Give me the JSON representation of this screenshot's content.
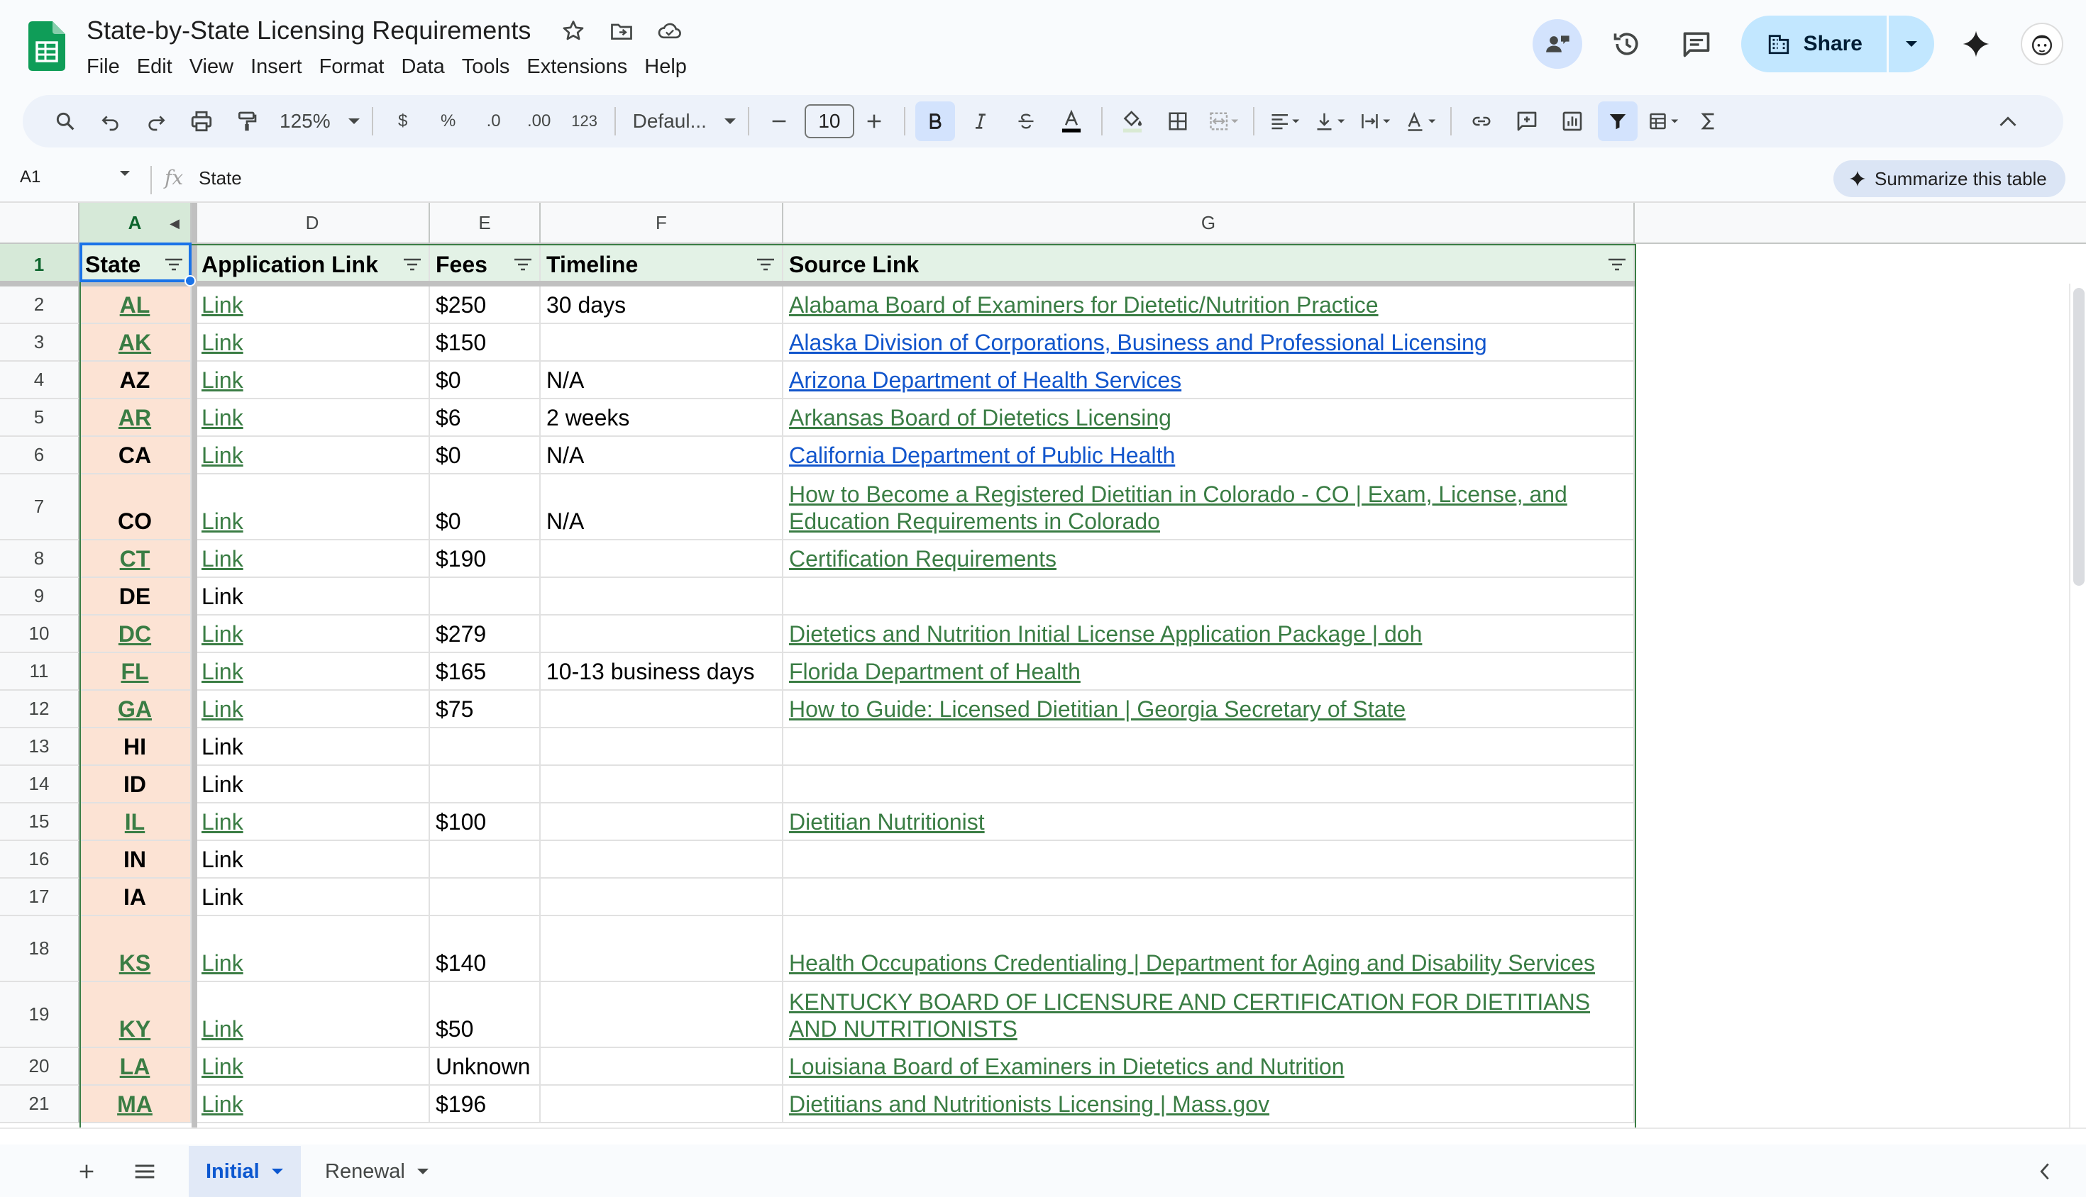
{
  "title": "State-by-State Licensing Requirements",
  "menu": [
    "File",
    "Edit",
    "View",
    "Insert",
    "Format",
    "Data",
    "Tools",
    "Extensions",
    "Help"
  ],
  "share_label": "Share",
  "toolbar": {
    "zoom": "125%",
    "font": "Defaul...",
    "font_size": "10",
    "currency": "$",
    "percent": "%",
    "dec_decrease": ".0",
    "dec_increase": ".00",
    "number_format": "123"
  },
  "formula_bar": {
    "cell_ref": "A1",
    "fx": "fx",
    "content": "State",
    "summarize_label": "Summarize this table"
  },
  "columns": [
    "A",
    "D",
    "E",
    "F",
    "G"
  ],
  "headers": {
    "state": "State",
    "app": "Application Link",
    "fees": "Fees",
    "timeline": "Timeline",
    "source": "Source Link"
  },
  "rows": [
    {
      "n": "1"
    },
    {
      "n": "2",
      "state": "AL",
      "state_link": true,
      "app": "Link",
      "app_link": true,
      "fees": "$250",
      "timeline": "30 days",
      "source": "Alabama Board of Examiners for Dietetic/Nutrition Practice",
      "source_color": "green"
    },
    {
      "n": "3",
      "state": "AK",
      "state_link": true,
      "app": "Link",
      "app_link": true,
      "fees": "$150",
      "timeline": "",
      "source": "Alaska Division of Corporations, Business and Professional Licensing",
      "source_color": "blue"
    },
    {
      "n": "4",
      "state": "AZ",
      "state_link": false,
      "app": "Link",
      "app_link": true,
      "fees": "$0",
      "timeline": "N/A",
      "source": "Arizona Department of Health Services",
      "source_color": "blue"
    },
    {
      "n": "5",
      "state": "AR",
      "state_link": true,
      "app": "Link",
      "app_link": true,
      "fees": "$6",
      "timeline": "2 weeks",
      "source": "Arkansas Board of Dietetics Licensing",
      "source_color": "green"
    },
    {
      "n": "6",
      "state": "CA",
      "state_link": false,
      "app": "Link",
      "app_link": true,
      "fees": "$0",
      "timeline": "N/A",
      "source": "California Department of Public Health",
      "source_color": "blue"
    },
    {
      "n": "7",
      "state": "CO",
      "state_link": false,
      "app": "Link",
      "app_link": true,
      "fees": "$0",
      "timeline": "N/A",
      "source": "How to Become a Registered Dietitian in Colorado - CO | Exam, License, and Education Requirements in Colorado",
      "source_color": "green",
      "tall": true
    },
    {
      "n": "8",
      "state": "CT",
      "state_link": true,
      "app": "Link",
      "app_link": true,
      "fees": "$190",
      "timeline": "",
      "source": "Certification Requirements",
      "source_color": "green"
    },
    {
      "n": "9",
      "state": "DE",
      "state_link": false,
      "app": "Link",
      "app_link": false,
      "fees": "",
      "timeline": "",
      "source": "",
      "source_color": "green"
    },
    {
      "n": "10",
      "state": "DC",
      "state_link": true,
      "app": "Link",
      "app_link": true,
      "fees": "$279",
      "timeline": "",
      "source": "Dietetics and Nutrition Initial License Application Package | doh",
      "source_color": "green"
    },
    {
      "n": "11",
      "state": "FL",
      "state_link": true,
      "app": "Link",
      "app_link": true,
      "fees": "$165",
      "timeline": "10-13 business days",
      "source": "Florida Department of Health",
      "source_color": "green"
    },
    {
      "n": "12",
      "state": "GA",
      "state_link": true,
      "app": "Link",
      "app_link": true,
      "fees": "$75",
      "timeline": "",
      "source": "How to Guide: Licensed Dietitian | Georgia Secretary of State",
      "source_color": "green"
    },
    {
      "n": "13",
      "state": "HI",
      "state_link": false,
      "app": "Link",
      "app_link": false,
      "fees": "",
      "timeline": "",
      "source": "",
      "source_color": "green"
    },
    {
      "n": "14",
      "state": "ID",
      "state_link": false,
      "app": "Link",
      "app_link": false,
      "fees": "",
      "timeline": "",
      "source": "",
      "source_color": "green"
    },
    {
      "n": "15",
      "state": "IL",
      "state_link": true,
      "app": "Link",
      "app_link": true,
      "fees": "$100",
      "timeline": "",
      "source": "Dietitian Nutritionist",
      "source_color": "green"
    },
    {
      "n": "16",
      "state": "IN",
      "state_link": false,
      "app": "Link",
      "app_link": false,
      "fees": "",
      "timeline": "",
      "source": "",
      "source_color": "green"
    },
    {
      "n": "17",
      "state": "IA",
      "state_link": false,
      "app": "Link",
      "app_link": false,
      "fees": "",
      "timeline": "",
      "source": "",
      "source_color": "green"
    },
    {
      "n": "18",
      "state": "KS",
      "state_link": true,
      "app": "Link",
      "app_link": true,
      "fees": "$140",
      "timeline": "",
      "source": "Health Occupations Credentialing | Department for Aging and Disability Services",
      "source_color": "green",
      "tall": true
    },
    {
      "n": "19",
      "state": "KY",
      "state_link": true,
      "app": "Link",
      "app_link": true,
      "fees": "$50",
      "timeline": "",
      "source": "KENTUCKY BOARD OF LICENSURE AND CERTIFICATION FOR DIETITIANS AND NUTRITIONISTS",
      "source_color": "green",
      "tall": true
    },
    {
      "n": "20",
      "state": "LA",
      "state_link": true,
      "app": "Link",
      "app_link": true,
      "fees": "Unknown",
      "timeline": "",
      "source": "Louisiana Board of Examiners in Dietetics and Nutrition",
      "source_color": "green"
    },
    {
      "n": "21",
      "state": "MA",
      "state_link": true,
      "app": "Link",
      "app_link": true,
      "fees": "$196",
      "timeline": "",
      "source": "Dietitians and Nutritionists Licensing | Mass.gov",
      "source_color": "green"
    }
  ],
  "sheets": [
    {
      "label": "Initial",
      "active": true
    },
    {
      "label": "Renewal",
      "active": false
    }
  ],
  "colors": {
    "accent": "#1a73e8",
    "state_fill": "#fce3d4",
    "header_fill": "#e3f2e6",
    "table_border": "#3a7d44",
    "link_green": "#3a7d44",
    "link_blue": "#1155cc"
  }
}
